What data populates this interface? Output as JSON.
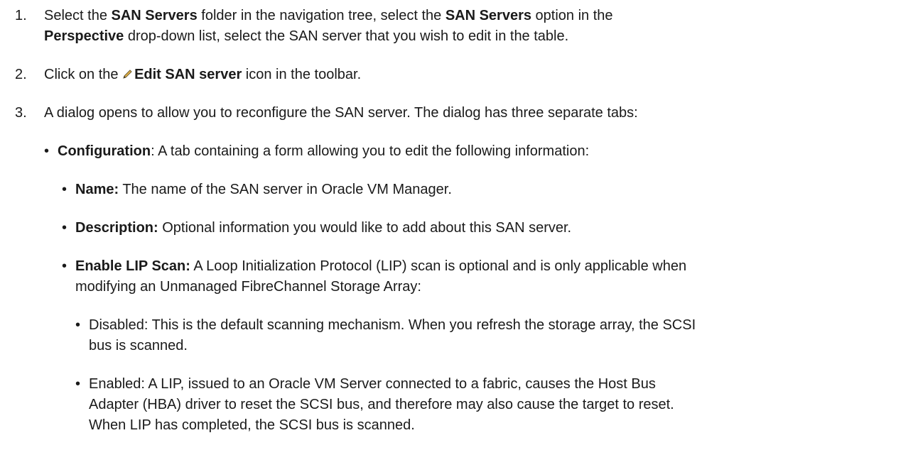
{
  "steps": [
    {
      "number": "1.",
      "line1": {
        "t1": "Select the ",
        "b1": "SAN Servers",
        "t2": " folder in the navigation tree, select the ",
        "b2": "SAN Servers",
        "t3": " option in the"
      },
      "line2": {
        "b1": "Perspective",
        "t1": " drop-down list, select the SAN server that you wish to edit in the table."
      }
    },
    {
      "number": "2.",
      "t1": "Click on the ",
      "icon": "pencil-icon",
      "b1": "Edit SAN server",
      "t2": " icon in the toolbar."
    },
    {
      "number": "3.",
      "text": "A dialog opens to allow you to reconfigure the SAN server. The dialog has three separate tabs:"
    }
  ],
  "tabs_list": [
    {
      "bold": "Configuration",
      "text": ": A tab containing a form allowing you to edit the following information:"
    }
  ],
  "fields": [
    {
      "bold": "Name:",
      "text": " The name of the SAN server in Oracle VM Manager."
    },
    {
      "bold": "Description:",
      "text": " Optional information you would like to add about this SAN server."
    },
    {
      "bold": "Enable LIP Scan:",
      "line1": " A Loop Initialization Protocol (LIP) scan is optional and is only applicable when",
      "line2": "modifying an Unmanaged FibreChannel Storage Array:"
    }
  ],
  "lip_options": [
    {
      "line1": "Disabled: This is the default scanning mechanism. When you refresh the storage array, the SCSI",
      "line2": "bus is scanned."
    },
    {
      "line1": "Enabled: A LIP, issued to an Oracle VM Server connected to a fabric, causes the Host Bus",
      "line2": "Adapter (HBA) driver to reset the SCSI bus, and therefore may also cause the target to reset.",
      "line3": "When LIP has completed, the SCSI bus is scanned."
    }
  ],
  "bullet_char": "•",
  "accent_color": "#1a1a1a"
}
